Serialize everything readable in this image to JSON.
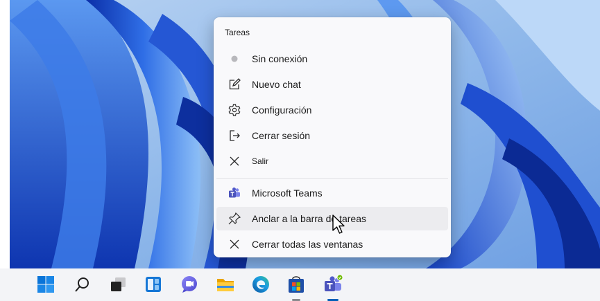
{
  "jumplist": {
    "header": "Tareas",
    "tasks": [
      {
        "label": "Sin conexión",
        "icon": "status-dot-icon"
      },
      {
        "label": "Nuevo chat",
        "icon": "compose-icon"
      },
      {
        "label": "Configuración",
        "icon": "gear-icon"
      },
      {
        "label": "Cerrar sesión",
        "icon": "sign-out-icon"
      },
      {
        "label": "Salir",
        "icon": "close-icon"
      }
    ],
    "app_actions": [
      {
        "label": "Microsoft Teams",
        "icon": "teams-icon"
      },
      {
        "label": "Anclar a la barra de tareas",
        "icon": "pin-icon",
        "hovered": true
      },
      {
        "label": "Cerrar todas las ventanas",
        "icon": "close-icon"
      }
    ]
  },
  "taskbar": {
    "icons": [
      "windows-start-icon",
      "search-icon",
      "task-view-icon",
      "widgets-icon",
      "teams-chat-icon",
      "file-explorer-icon",
      "edge-icon",
      "store-icon",
      "teams-icon"
    ],
    "active": "teams-icon"
  },
  "colors": {
    "wallpaper": "#1e56d6",
    "menu_bg": "#f9f9fb",
    "hover_bg": "#ececef",
    "teams": "#5b5fc7"
  }
}
